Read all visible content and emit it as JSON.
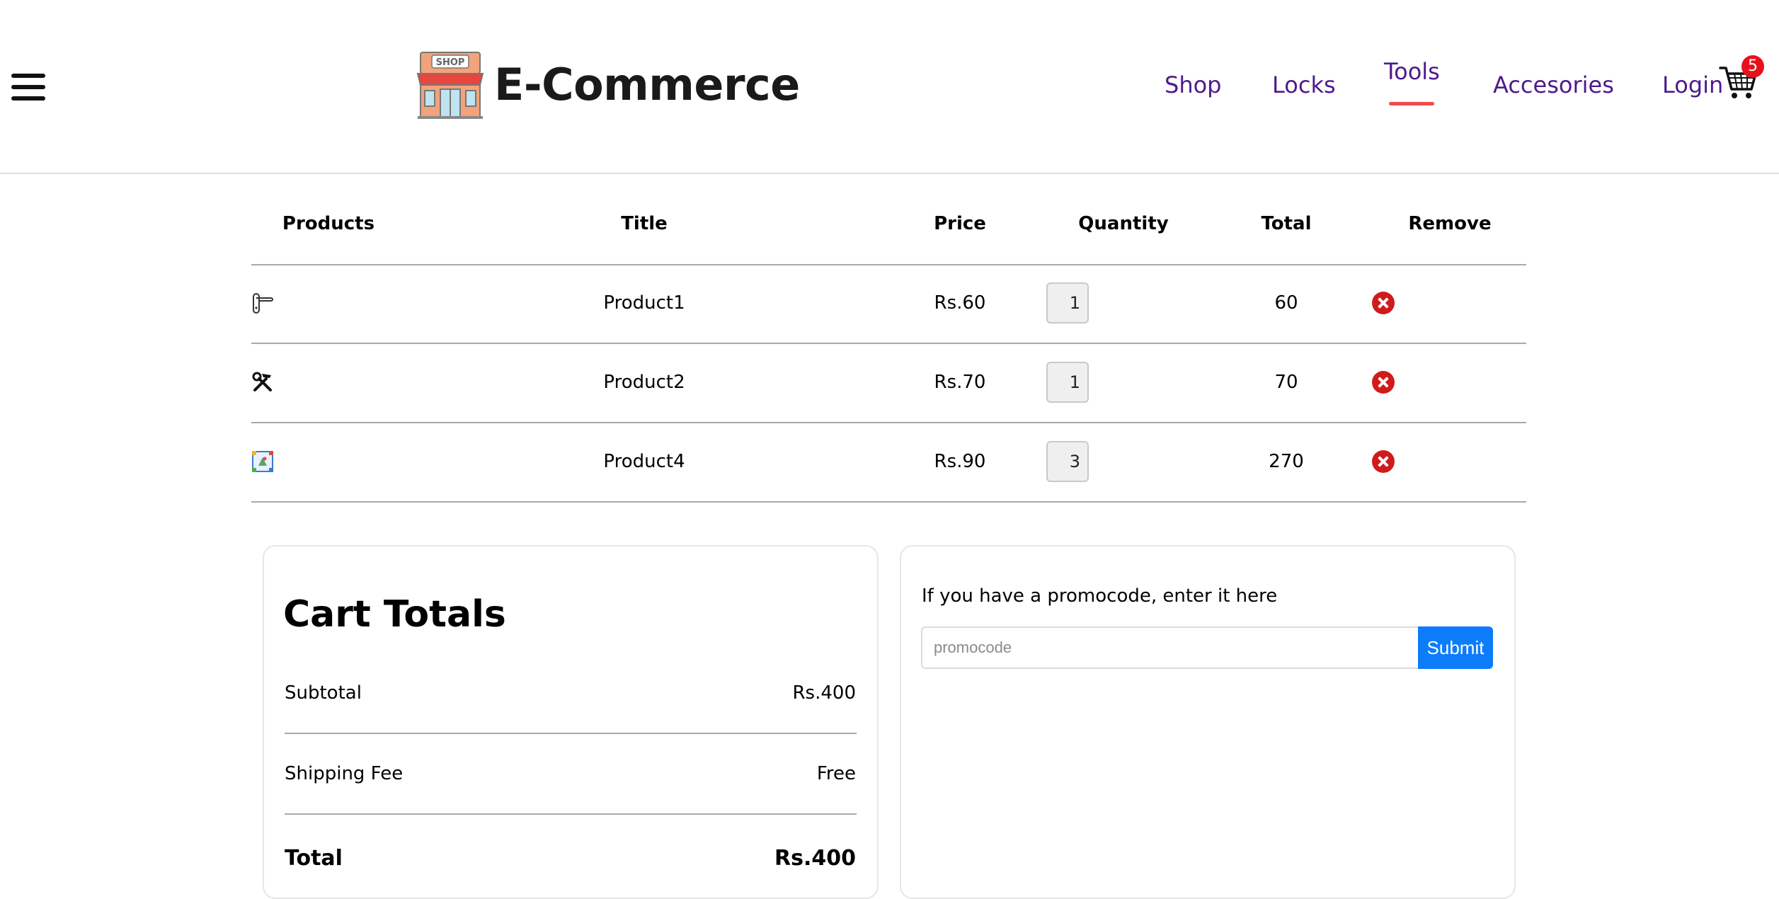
{
  "header": {
    "brand": "E-Commerce",
    "nav": [
      {
        "label": "Shop"
      },
      {
        "label": "Locks"
      },
      {
        "label": "Tools"
      },
      {
        "label": "Accesories"
      },
      {
        "label": "Login"
      }
    ],
    "active_nav": "Tools",
    "cart_count": "5"
  },
  "cart_table": {
    "columns": [
      "Products",
      "Title",
      "Price",
      "Quantity",
      "Total",
      "Remove"
    ],
    "rows": [
      {
        "icon": "door-handle-icon",
        "title": "Product1",
        "price": "Rs.60",
        "quantity": "1",
        "total": "60"
      },
      {
        "icon": "hammer-wrench-icon",
        "title": "Product2",
        "price": "Rs.70",
        "quantity": "1",
        "total": "70"
      },
      {
        "icon": "frame-icon",
        "title": "Product4",
        "price": "Rs.90",
        "quantity": "3",
        "total": "270"
      }
    ]
  },
  "cart_totals": {
    "title": "Cart Totals",
    "subtotal_label": "Subtotal",
    "subtotal_value": "Rs.400",
    "shipping_label": "Shipping Fee",
    "shipping_value": "Free",
    "total_label": "Total",
    "total_value": "Rs.400"
  },
  "promo": {
    "prompt": "If you have a promocode, enter it here",
    "placeholder": "promocode",
    "value": "",
    "submit_label": "Submit"
  },
  "colors": {
    "nav_text": "#4f1a8c",
    "active_underline": "#f04a4a",
    "remove_icon": "#d11a1a",
    "submit_button": "#0d7cfb",
    "badge": "#e8101d"
  }
}
